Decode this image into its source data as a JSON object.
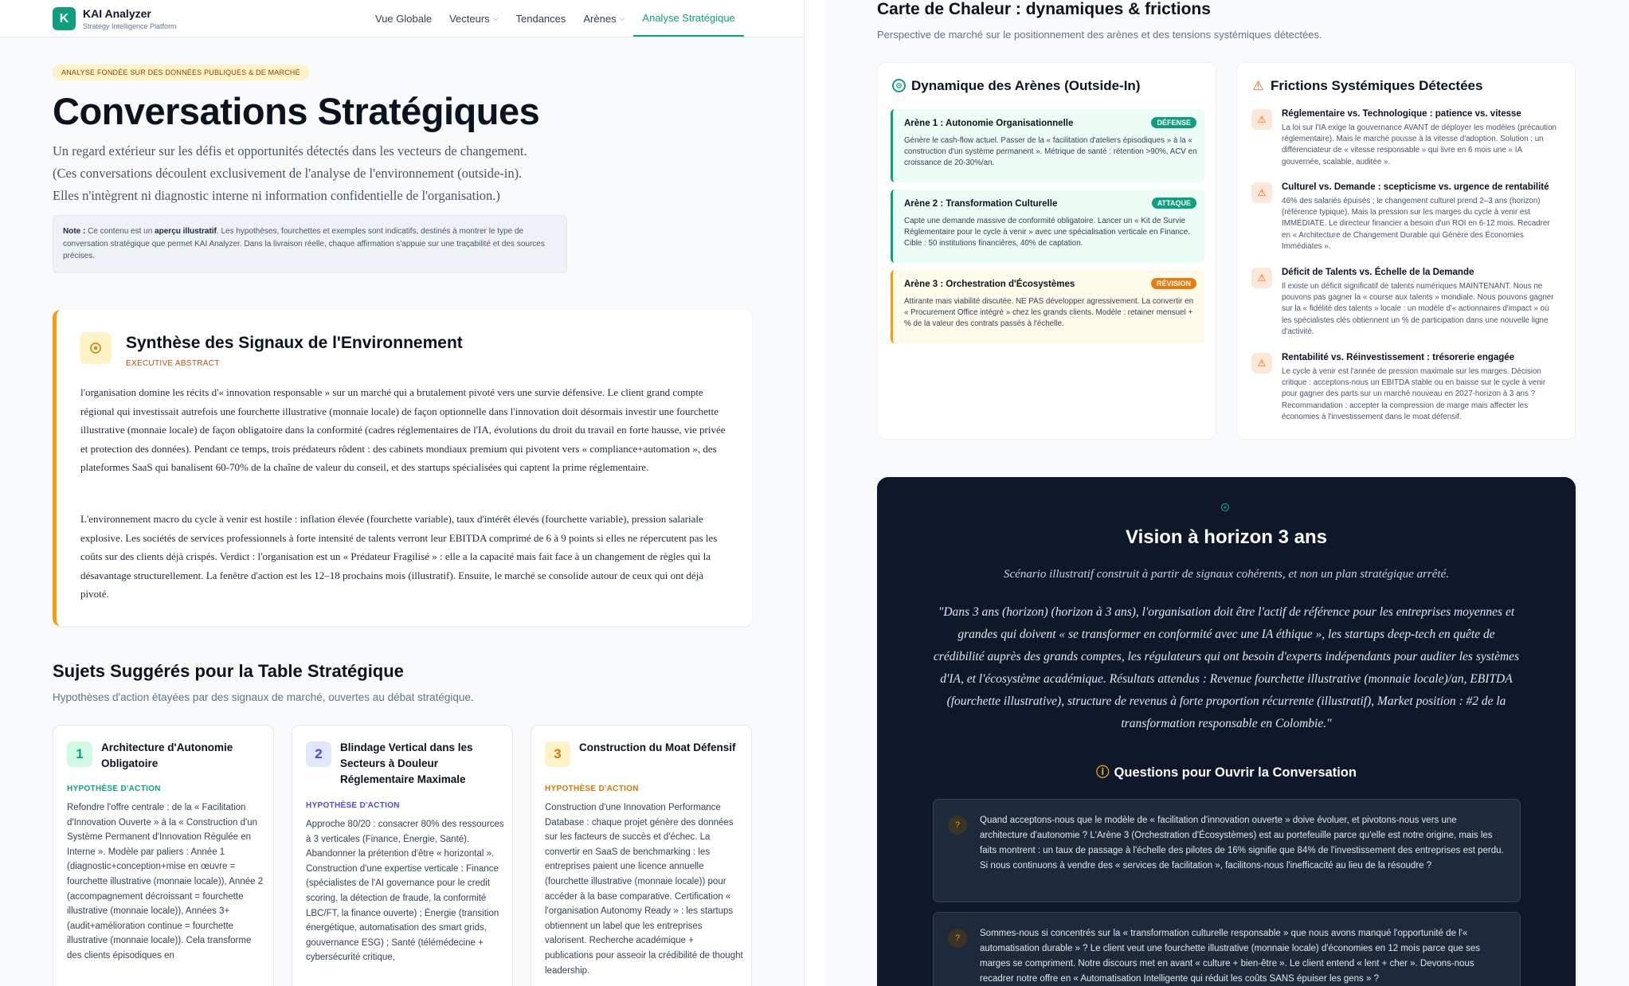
{
  "nav": {
    "logo_letter": "K",
    "brand": "KAI Analyzer",
    "brand_sub": "Strategy Intelligence Platform",
    "items": [
      {
        "label": "Vue Globale",
        "dropdown": false
      },
      {
        "label": "Vecteurs",
        "dropdown": true
      },
      {
        "label": "Tendances",
        "dropdown": false
      },
      {
        "label": "Arènes",
        "dropdown": true
      },
      {
        "label": "Analyse Stratégique",
        "dropdown": false,
        "active": true
      }
    ]
  },
  "header": {
    "badge": "Analyse fondée sur des données publiques & de marché",
    "title": "Conversations Stratégiques",
    "intro_1": "Un regard extérieur sur les défis et opportunités détectés dans les vecteurs de changement.",
    "intro_2": "(Ces conversations découlent exclusivement de l'analyse de l'environnement (outside-in).",
    "intro_3": "Elles n'intègrent ni diagnostic interne ni information confidentielle de l'organisation.)",
    "note_label": "Note :",
    "note_pre": "Ce contenu est un",
    "note_bold": "aperçu illustratif",
    "note_post": ". Les hypothèses, fourchettes et exemples sont indicatifs, destinés à montrer le type de conversation stratégique que permet KAI Analyzer. Dans la livraison réelle, chaque affirmation s'appuie sur une traçabilité et des sources précises."
  },
  "synthesis": {
    "title": "Synthèse des Signaux de l'Environnement",
    "subtitle": "EXECUTIVE ABSTRACT",
    "p1": "l'organisation domine les récits d'« innovation responsable » sur un marché qui a brutalement pivoté vers une survie défensive. Le client grand compte régional qui investissait autrefois une fourchette illustrative (monnaie locale) de façon optionnelle dans l'innovation doit désormais investir une fourchette illustrative (monnaie locale) de façon obligatoire dans la conformité (cadres réglementaires de l'IA, évolutions du droit du travail en forte hausse, vie privée et protection des données). Pendant ce temps, trois prédateurs rôdent : des cabinets mondiaux premium qui pivotent vers « compliance+automation », des plateformes SaaS qui banalisent 60-70% de la chaîne de valeur du conseil, et des startups spécialisées qui captent la prime réglementaire.",
    "p2": "L'environnement macro du cycle à venir est hostile : inflation élevée (fourchette variable), taux d'intérêt élevés (fourchette variable), pression salariale explosive. Les sociétés de services professionnels à forte intensité de talents verront leur EBITDA comprimé de 6 à 9 points si elles ne répercutent pas les coûts sur des clients déjà crispés. Verdict : l'organisation est un « Prédateur Fragilisé » : elle a la capacité mais fait face à un changement de règles qui la désavantage structurellement. La fenêtre d'action est les 12–18 prochains mois (illustratif). Ensuite, le marché se consolide autour de ceux qui ont déjà pivoté."
  },
  "topics": {
    "title": "Sujets Suggérés pour la Table Stratégique",
    "subtitle": "Hypothèses d'action étayées par des signaux de marché, ouvertes au débat stratégique.",
    "label": "HYPOTHÈSE D'ACTION",
    "cards": [
      {
        "num": "1",
        "name": "Architecture d'Autonomie Obligatoire",
        "text": "Refondre l'offre centrale : de la « Facilitation d'Innovation Ouverte » à la « Construction d'un Système Permanent d'Innovation Régulée en Interne ». Modèle par paliers : Année 1 (diagnostic+conception+mise en œuvre = fourchette illustrative (monnaie locale)), Année 2 (accompagnement décroissant = fourchette illustrative (monnaie locale)), Années 3+ (audit+amélioration continue = fourchette illustrative (monnaie locale)). Cela transforme des clients épisodiques en"
      },
      {
        "num": "2",
        "name": "Blindage Vertical dans les Secteurs à Douleur Réglementaire Maximale",
        "text": "Approche 80/20 : consacrer 80% des ressources à 3 verticales (Finance, Énergie, Santé). Abandonner la prétention d'être « horizontal ». Construction d'une expertise verticale : Finance (spécialistes de l'AI governance pour le credit scoring, la détection de fraude, la conformité LBC/FT, la finance ouverte) ; Énergie (transition énergétique, automatisation des smart grids, gouvernance ESG) ; Santé (télémédecine + cybersécurité critique,"
      },
      {
        "num": "3",
        "name": "Construction du Moat Défensif",
        "text": "Construction d'une Innovation Performance Database : chaque projet génère des données sur les facteurs de succès et d'échec. La convertir en SaaS de benchmarking : les entreprises paient une licence annuelle (fourchette illustrative (monnaie locale)) pour accéder à la base comparative. Certification « l'organisation Autonomy Ready » : les startups obtiennent un label que les entreprises valorisent. Recherche académique + publications pour asseoir la crédibilité de thought leadership."
      }
    ]
  },
  "heatmap": {
    "title": "Carte de Chaleur : dynamiques & frictions",
    "subtitle": "Perspective de marché sur le positionnement des arènes et des tensions systémiques détectées."
  },
  "arenas": {
    "title": "Dynamique des Arènes (Outside-In)",
    "items": [
      {
        "name": "Arène 1 : Autonomie Organisationnelle",
        "tag": "DÉFENSE",
        "desc": "Génère le cash-flow actuel. Passer de la « facilitation d'ateliers épisodiques » à la « construction d'un système permanent ». Métrique de santé : rétention >90%, ACV en croissance de 20-30%/an."
      },
      {
        "name": "Arène 2 : Transformation Culturelle",
        "tag": "ATTAQUE",
        "desc": "Capte une demande massive de conformité obligatoire. Lancer un « Kit de Survie Réglementaire pour le cycle à venir » avec une spécialisation verticale en Finance. Cible : 50 institutions financières, 40% de captation."
      },
      {
        "name": "Arène 3 : Orchestration d'Écosystèmes",
        "tag": "RÉVISION",
        "desc": "Attirante mais viabilité discutée. NE PAS développer agressivement. La convertir en « Procurement Office intégré » chez les grands clients. Modèle : retainer mensuel + % de la valeur des contrats passés à l'échelle."
      }
    ]
  },
  "frictions": {
    "title": "Frictions Systémiques Détectées",
    "items": [
      {
        "title": "Réglementaire vs. Technologique : patience vs. vitesse",
        "text": "La loi sur l'IA exige la gouvernance AVANT de déployer les modèles (précaution réglementaire). Mais le marché pousse à la vitesse d'adoption. Solution : un différenciateur de « vitesse responsable » qui livre en 6 mois une « IA gouvernée, scalable, auditée »."
      },
      {
        "title": "Culturel vs. Demande : scepticisme vs. urgence de rentabilité",
        "text": "46% des salariés épuisés ; le changement culturel prend 2–3 ans (horizon) (référence typique). Mais la pression sur les marges du cycle à venir est IMMÉDIATE. Le directeur financier a besoin d'un ROI en 6-12 mois. Recadrer en « Architecture de Changement Durable qui Génère des Économies Immédiates »."
      },
      {
        "title": "Déficit de Talents vs. Échelle de la Demande",
        "text": "Il existe un déficit significatif de talents numériques MAINTENANT. Nous ne pouvons pas gagner la « course aux talents » mondiale. Nous pouvons gagner sur la « fidélité des talents » locale : un modèle d'« actionnaires d'impact » où les spécialistes clés obtiennent un % de participation dans une nouvelle ligne d'activité."
      },
      {
        "title": "Rentabilité vs. Réinvestissement : trésorerie engagée",
        "text": "Le cycle à venir est l'année de pression maximale sur les marges. Décision critique : acceptons-nous un EBITDA stable ou en baisse sur le cycle à venir pour gagner des parts sur un marché nouveau en 2027-horizon à 3 ans ? Recommandation : accepter la compression de marge mais affecter les économies à l'investissement dans le moat défensif."
      }
    ]
  },
  "vision": {
    "title": "Vision à horizon 3 ans",
    "subtitle": "Scénario illustratif construit à partir de signaux cohérents, et non un plan stratégique arrêté.",
    "quote": "\"Dans 3 ans (horizon) (horizon à 3 ans), l'organisation doit être l'actif de référence pour les entreprises moyennes et grandes qui doivent « se transformer en conformité avec une IA éthique », les startups deep-tech en quête de crédibilité auprès des grands comptes, les régulateurs qui ont besoin d'experts indépendants pour auditer les systèmes d'IA, et l'écosystème académique. Résultats attendus : Revenue fourchette illustrative (monnaie locale)/an, EBITDA (fourchette illustrative), structure de revenus à forte proportion récurrente (illustratif), Market position : #2 de la transformation responsable en Colombie.\"",
    "questions_title": "Questions pour Ouvrir la Conversation",
    "questions": [
      "Quand acceptons-nous que le modèle de « facilitation d'innovation ouverte » doive évoluer, et pivotons-nous vers une architecture d'autonomie ? L'Arène 3 (Orchestration d'Écosystèmes) est au portefeuille parce qu'elle est notre origine, mais les faits montrent : un taux de passage à l'échelle des pilotes de 16% signifie que 84% de l'investissement des entreprises est perdu. Si nous continuons à vendre des « services de facilitation », facilitons-nous l'inefficacité au lieu de la résoudre ?",
      "Sommes-nous si concentrés sur la « transformation culturelle responsable » que nous avons manqué l'opportunité de l'« automatisation durable » ? Le client veut une fourchette illustrative (monnaie locale) d'économies en 12 mois parce que ses marges se compriment. Notre discours met en avant « culture + bien-être ». Le client entend « lent + cher ». Devons-nous recadrer notre offre en « Automatisation Intelligente qui réduit les coûts SANS épuiser les gens » ?"
    ]
  },
  "colors": {
    "accent": "#0f9f7f",
    "arena_defense": "#0f9f7f",
    "arena_attack": "#0f9f7f",
    "arena_revision": "#ea7a0c",
    "synthesis_border": "#f59e0b",
    "vision_bg": "#0f172a"
  }
}
